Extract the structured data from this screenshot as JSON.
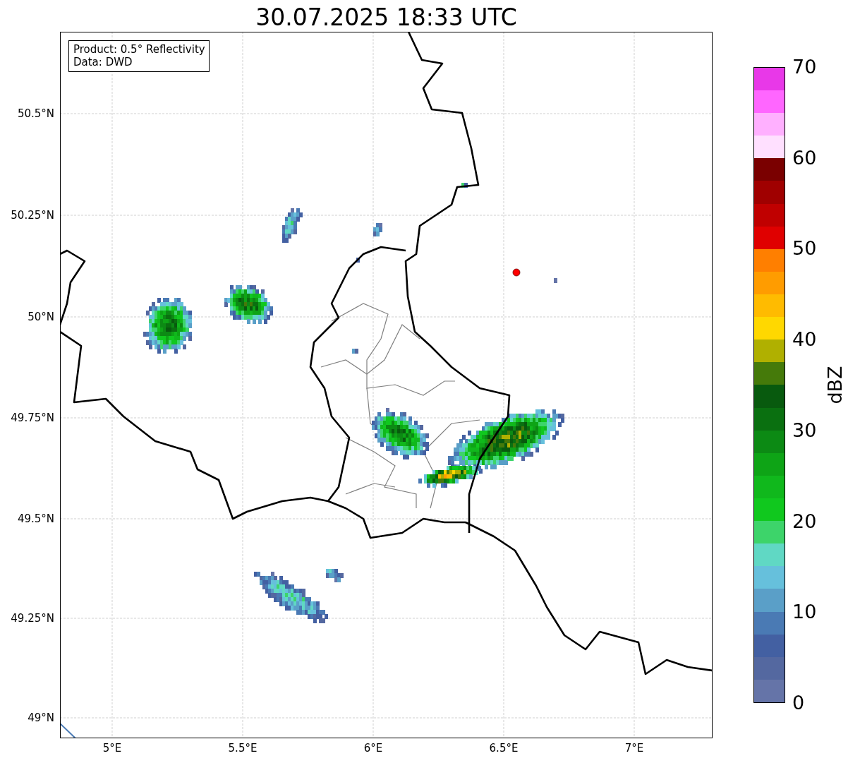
{
  "title": "30.07.2025 18:33 UTC",
  "legend": {
    "lines": [
      "Product: 0.5° Reflectivity",
      "Data: DWD"
    ]
  },
  "map": {
    "lat_ticks": [
      "50.5°N",
      "50.25°N",
      "50°N",
      "49.75°N",
      "49.5°N",
      "49.25°N",
      "49°N"
    ],
    "lon_ticks": [
      "5°E",
      "5.5°E",
      "6°E",
      "6.5°E",
      "7°E"
    ]
  },
  "colorbar": {
    "label": "dBZ",
    "ticks": [
      "70",
      "60",
      "50",
      "40",
      "30",
      "20",
      "10",
      "0"
    ],
    "bins": [
      {
        "color": "#6574a8"
      },
      {
        "color": "#5468a0"
      },
      {
        "color": "#4360a2"
      },
      {
        "color": "#4a7ab4"
      },
      {
        "color": "#5a9fc8"
      },
      {
        "color": "#66c0dc"
      },
      {
        "color": "#60d8c4"
      },
      {
        "color": "#3dd46a"
      },
      {
        "color": "#10c81e"
      },
      {
        "color": "#10b81c"
      },
      {
        "color": "#0ea416"
      },
      {
        "color": "#0c8a14"
      },
      {
        "color": "#0a7010"
      },
      {
        "color": "#085a0e"
      },
      {
        "color": "#457a0a"
      },
      {
        "color": "#b0b000"
      },
      {
        "color": "#ffd800"
      },
      {
        "color": "#ffbb00"
      },
      {
        "color": "#ff9c00"
      },
      {
        "color": "#ff7f00"
      },
      {
        "color": "#e00000"
      },
      {
        "color": "#c00000"
      },
      {
        "color": "#a00000"
      },
      {
        "color": "#7a0000"
      },
      {
        "color": "#ffe0ff"
      },
      {
        "color": "#ffb0ff"
      },
      {
        "color": "#ff66ff"
      },
      {
        "color": "#e838e8"
      }
    ]
  }
}
